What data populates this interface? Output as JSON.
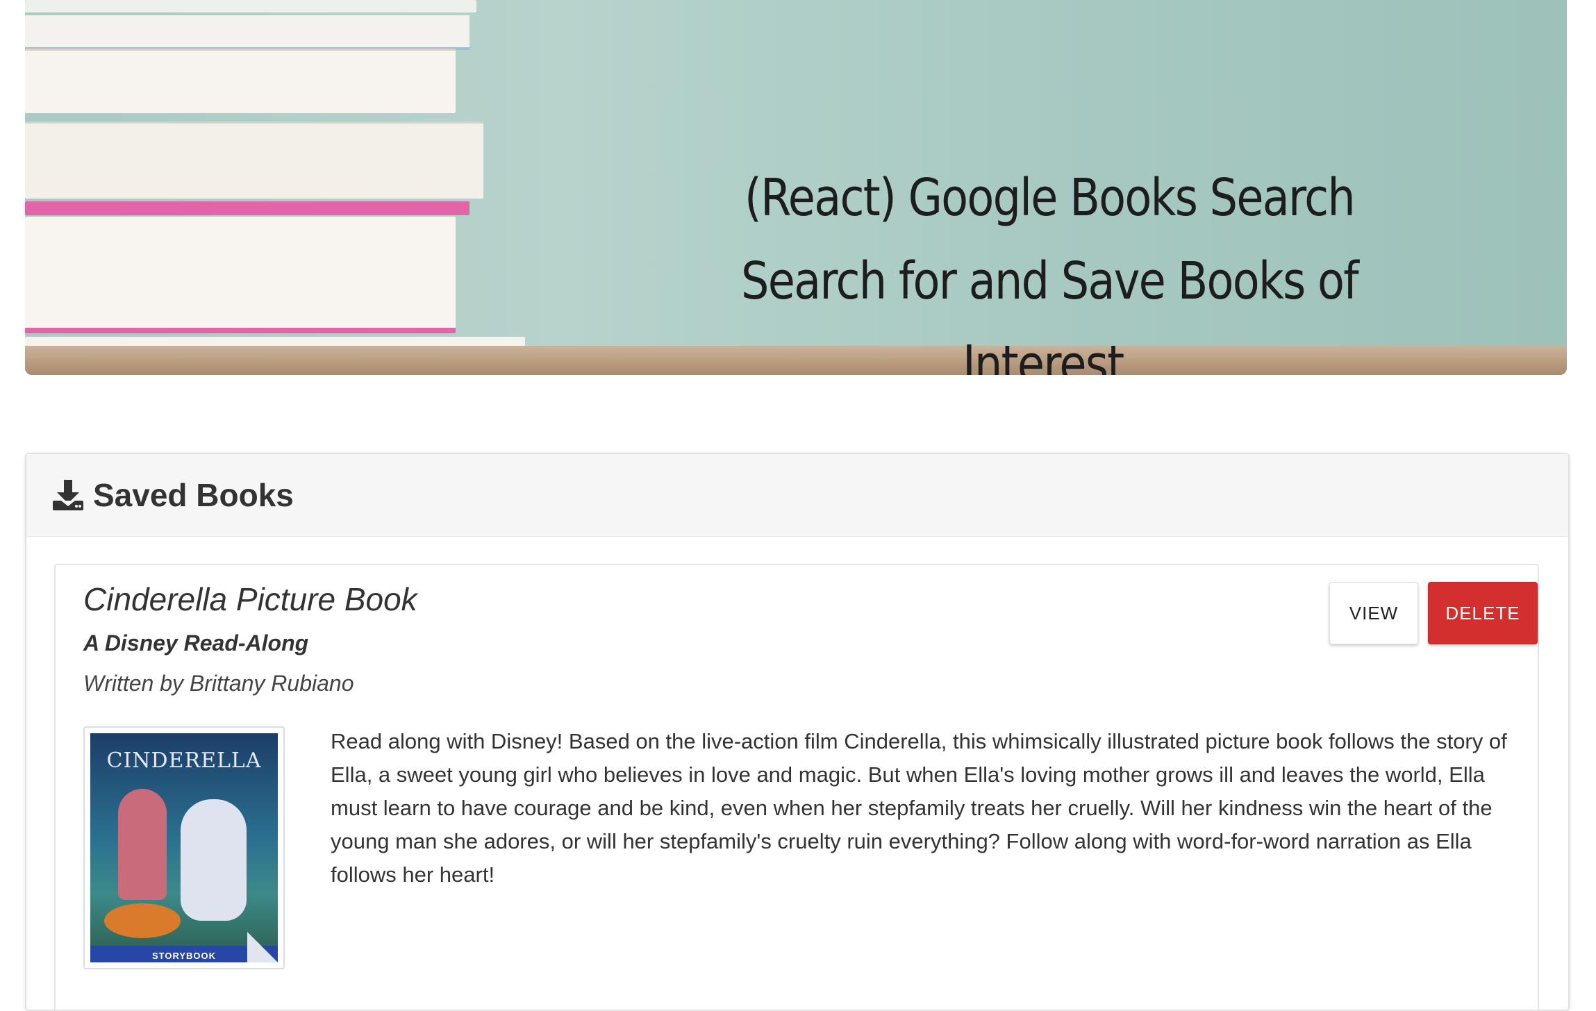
{
  "banner": {
    "title_line1": "(React) Google Books Search",
    "title_line2": "Search for and Save Books of Interest."
  },
  "saved_books": {
    "header": "Saved Books",
    "header_icon": "download-icon",
    "items": [
      {
        "title": "Cinderella Picture Book",
        "subtitle": "A Disney Read-Along",
        "author": "Written by Brittany Rubiano",
        "view_label": "VIEW",
        "delete_label": "DELETE",
        "cover_title": "CINDERELLA",
        "cover_bar_text": "STORYBOOK",
        "description": "Read along with Disney! Based on the live-action film Cinderella, this whimsically illustrated picture book follows the story of Ella, a sweet young girl who believes in love and magic. But when Ella's loving mother grows ill and leaves the world, Ella must learn to have courage and be kind, even when her stepfamily treats her cruelly. Will her kindness win the heart of the young man she adores, or will her stepfamily's cruelty ruin everything? Follow along with word-for-word narration as Ella follows her heart!"
      }
    ]
  },
  "colors": {
    "delete_button": "#d32f2f",
    "banner_background": "#a9cbc3",
    "card_header": "#f6f6f6"
  }
}
